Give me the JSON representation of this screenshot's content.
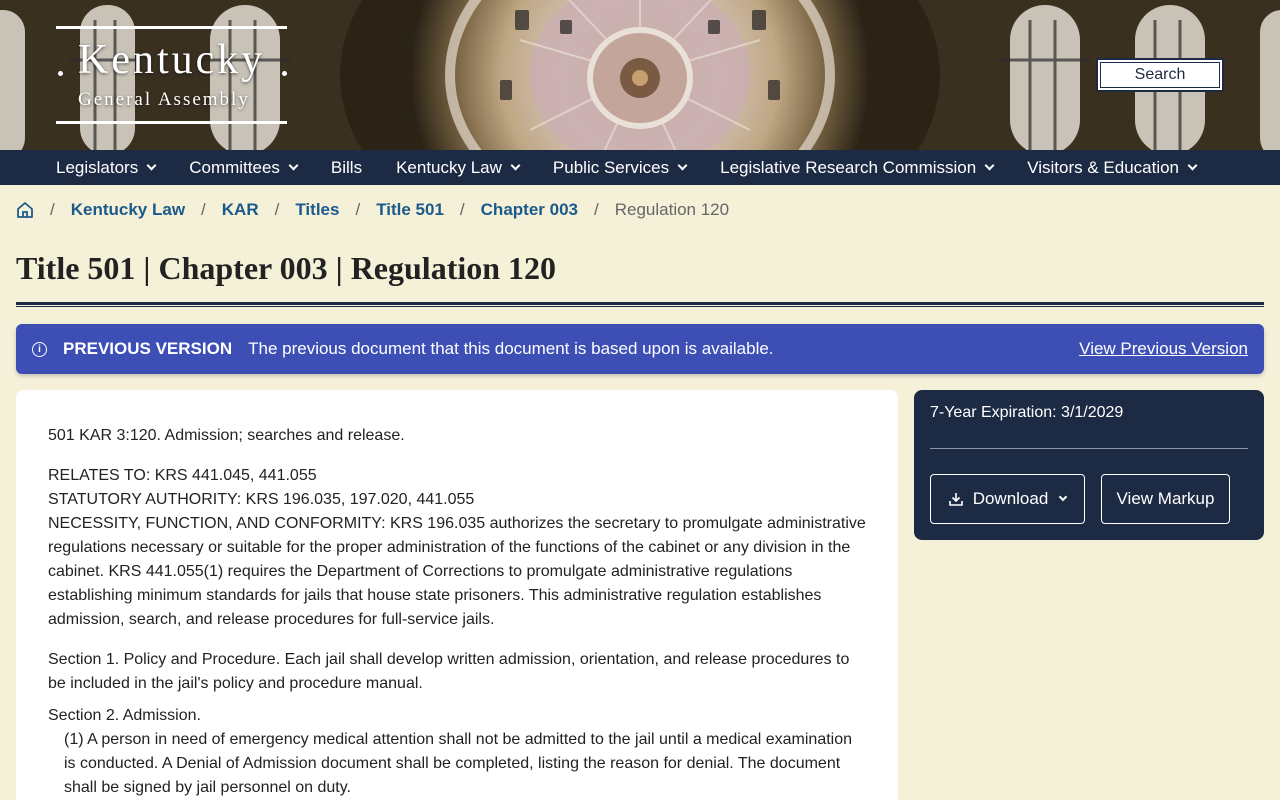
{
  "header": {
    "logo_title": "Kentucky",
    "logo_subtitle": "General Assembly",
    "search_label": "Search"
  },
  "nav": {
    "items": [
      {
        "label": "Legislators",
        "dropdown": true
      },
      {
        "label": "Committees",
        "dropdown": true
      },
      {
        "label": "Bills",
        "dropdown": false
      },
      {
        "label": "Kentucky Law",
        "dropdown": true
      },
      {
        "label": "Public Services",
        "dropdown": true
      },
      {
        "label": "Legislative Research Commission",
        "dropdown": true
      },
      {
        "label": "Visitors & Education",
        "dropdown": true
      }
    ]
  },
  "breadcrumb": {
    "home_icon": "home-icon",
    "links": [
      "Kentucky Law",
      "KAR",
      "Titles",
      "Title 501",
      "Chapter 003"
    ],
    "current": "Regulation 120",
    "separator": "/"
  },
  "page": {
    "title": "Title 501 | Chapter 003 | Regulation 120"
  },
  "alert": {
    "icon": "info-icon",
    "label": "PREVIOUS VERSION",
    "text": "The previous document that this document is based upon is available.",
    "link": "View Previous Version"
  },
  "document": {
    "heading": "501 KAR 3:120.  Admission; searches and release.",
    "relates_to": "RELATES TO:  KRS 441.045, 441.055",
    "statutory_authority": "STATUTORY AUTHORITY:  KRS 196.035, 197.020, 441.055",
    "necessity": "NECESSITY, FUNCTION, AND CONFORMITY:  KRS 196.035 authorizes the secretary to promulgate administrative regulations necessary or suitable for the proper administration of the functions of the cabinet or any division in the cabinet. KRS 441.055(1) requires the Department of Corrections to promulgate administrative regulations establishing minimum standards for jails that house state prisoners. This administrative regulation establishes admission, search, and release procedures for full-service jails.",
    "section1": "Section 1.  Policy and Procedure. Each jail shall develop written admission, orientation, and release procedures to be included in the jail's policy and procedure manual.",
    "section2": "Section 2.  Admission.",
    "section2_1": "(1)  A person in need of emergency medical attention shall not be admitted to the jail until a medical examination is conducted. A Denial of Admission document shall be completed, listing the reason for denial. The document shall be signed by jail personnel on duty."
  },
  "side_panel": {
    "expiration": "7-Year Expiration: 3/1/2029",
    "download_label": "Download",
    "markup_label": "View Markup"
  },
  "colors": {
    "background": "#f5f0d8",
    "nav": "#1c2a44",
    "alert": "#3d4fb5",
    "link": "#1c5a8c"
  }
}
